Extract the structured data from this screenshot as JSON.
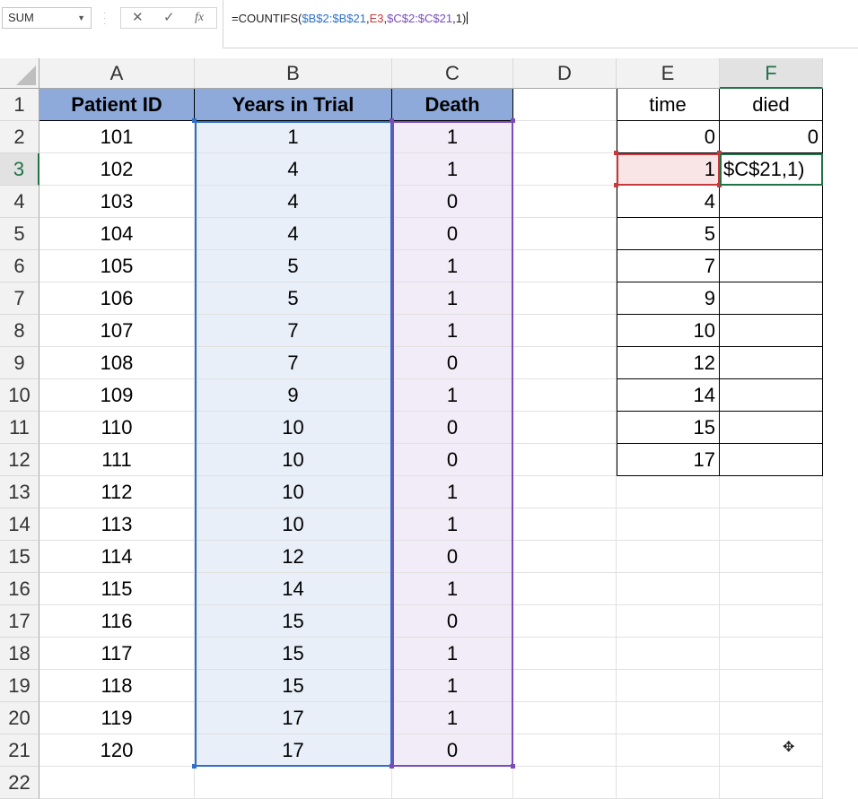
{
  "name_box": {
    "value": "SUM"
  },
  "formula_bar": {
    "cancel_symbol": "✕",
    "enter_symbol": "✓",
    "fx_symbol": "fx",
    "parts": [
      {
        "text": "=COUNTIFS(",
        "color": "default"
      },
      {
        "text": "$B$2:$B$21",
        "color": "blue"
      },
      {
        "text": ",",
        "color": "default"
      },
      {
        "text": "E3",
        "color": "red"
      },
      {
        "text": ",",
        "color": "default"
      },
      {
        "text": "$C$2:$C$21",
        "color": "purple"
      },
      {
        "text": ",1)",
        "color": "default"
      }
    ]
  },
  "columns": [
    "A",
    "B",
    "C",
    "D",
    "E",
    "F"
  ],
  "rows": [
    "1",
    "2",
    "3",
    "4",
    "5",
    "6",
    "7",
    "8",
    "9",
    "10",
    "11",
    "12",
    "13",
    "14",
    "15",
    "16",
    "17",
    "18",
    "19",
    "20",
    "21",
    "22"
  ],
  "table": {
    "headers": [
      "Patient ID",
      "Years in Trial",
      "Death"
    ],
    "rows": [
      [
        "101",
        "1",
        "1"
      ],
      [
        "102",
        "4",
        "1"
      ],
      [
        "103",
        "4",
        "0"
      ],
      [
        "104",
        "4",
        "0"
      ],
      [
        "105",
        "5",
        "1"
      ],
      [
        "106",
        "5",
        "1"
      ],
      [
        "107",
        "7",
        "1"
      ],
      [
        "108",
        "7",
        "0"
      ],
      [
        "109",
        "9",
        "1"
      ],
      [
        "110",
        "10",
        "0"
      ],
      [
        "111",
        "10",
        "0"
      ],
      [
        "112",
        "10",
        "1"
      ],
      [
        "113",
        "10",
        "1"
      ],
      [
        "114",
        "12",
        "0"
      ],
      [
        "115",
        "14",
        "1"
      ],
      [
        "116",
        "15",
        "0"
      ],
      [
        "117",
        "15",
        "1"
      ],
      [
        "118",
        "15",
        "1"
      ],
      [
        "119",
        "17",
        "1"
      ],
      [
        "120",
        "17",
        "0"
      ]
    ]
  },
  "side_table": {
    "headers": [
      "time",
      "died"
    ],
    "rows": [
      [
        "0",
        "0"
      ],
      [
        "1",
        "$C$21,1)"
      ],
      [
        "4",
        ""
      ],
      [
        "5",
        ""
      ],
      [
        "7",
        ""
      ],
      [
        "9",
        ""
      ],
      [
        "10",
        ""
      ],
      [
        "12",
        ""
      ],
      [
        "14",
        ""
      ],
      [
        "15",
        ""
      ],
      [
        "17",
        ""
      ]
    ]
  },
  "active_column": "F",
  "active_row": "3",
  "colors": {
    "header_fill": "#8eaadb",
    "excel_green": "#217346",
    "ref_blue": "#2e6fc7",
    "ref_red": "#c8393e",
    "ref_purple": "#7a4cb9"
  }
}
